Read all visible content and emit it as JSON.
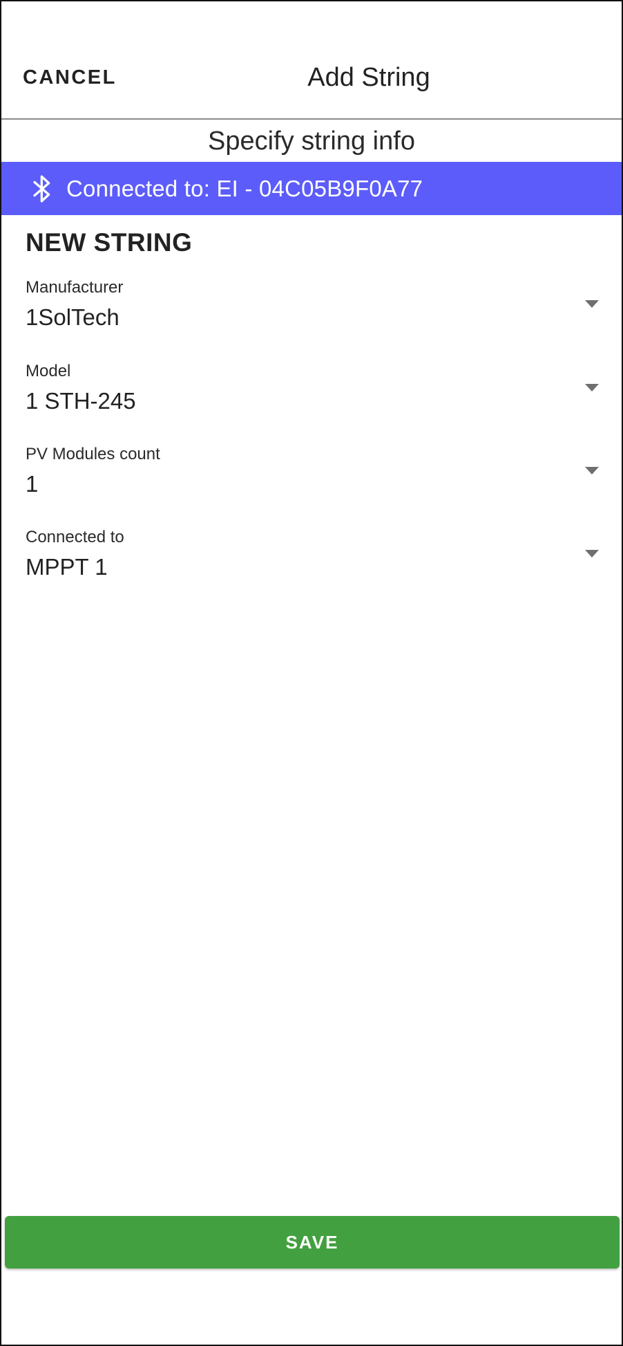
{
  "appbar": {
    "cancel_label": "CANCEL",
    "title": "Add String"
  },
  "subtitle": "Specify string info",
  "connection": {
    "icon": "bluetooth-icon",
    "text": "Connected to: EI - 04C05B9F0A77",
    "color": "#5c5cfa"
  },
  "form": {
    "section_title": "NEW STRING",
    "fields": [
      {
        "label": "Manufacturer",
        "value": "1SolTech"
      },
      {
        "label": "Model",
        "value": "1 STH-245"
      },
      {
        "label": "PV Modules count",
        "value": "1"
      },
      {
        "label": "Connected to",
        "value": "MPPT 1"
      }
    ]
  },
  "save": {
    "label": "SAVE",
    "color": "#43a040"
  }
}
